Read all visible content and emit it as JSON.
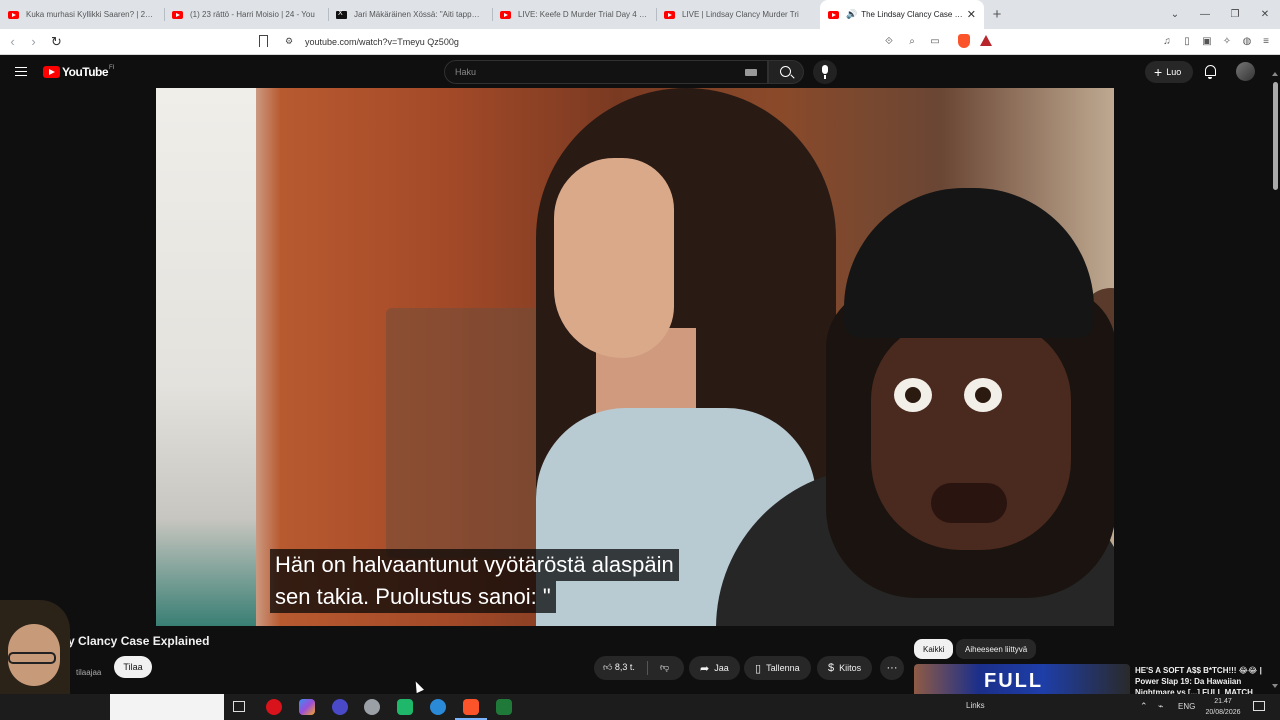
{
  "browser": {
    "tabs": [
      {
        "title": "Kuka murhasi Kyllikki Saaren? | 23 m",
        "icon": "youtube-icon",
        "active": false
      },
      {
        "title": "(1) 23 rättö - Harri Moisio | 24 - You",
        "icon": "youtube-icon",
        "active": false
      },
      {
        "title": "Jari Mäkäräinen Xössä: \"Aiti tappaa k",
        "icon": "x-icon",
        "active": false
      },
      {
        "title": "LIVE: Keefe D Murder Trial Day 4 | Off",
        "icon": "youtube-icon",
        "active": false
      },
      {
        "title": "LIVE | Lindsay Clancy Murder Tri",
        "icon": "youtube-icon",
        "active": false
      },
      {
        "title": "The Lindsay Clancy Case Expl",
        "icon": "youtube-icon",
        "active": true
      }
    ],
    "new_tab": "+",
    "url": "youtube.com/watch?v=Tmeyu Qz500g"
  },
  "youtube": {
    "logo_text": "YouTube",
    "country_code": "FI",
    "search_placeholder": "Haku",
    "create_label": "Luo",
    "subtitle_line1": "Hän on halvaantunut vyötäröstä alaspäin",
    "subtitle_line2": "sen takia. Puolustus sanoi: \"",
    "video_title": "y Clancy Case Explained",
    "channel_name": "tilaajaa",
    "subscribe_label": "Tilaa",
    "like_count": "8,3 t.",
    "share_label": "Jaa",
    "save_label": "Tallenna",
    "thanks_label": "Kiitos",
    "chips": [
      "Kaikki",
      "Aiheeseen liittyvä"
    ],
    "recommended": {
      "thumb_text": "FULL",
      "title": "HE'S A SOFT A$$ B*TCH!!! 😂😂 | Power Slap 19: Da Hawaiian Nightmare vs [...] FULL MATCH"
    }
  },
  "taskbar": {
    "links_label": "Links",
    "language": "ENG",
    "time": "21.47",
    "date": "20/08/2026"
  },
  "colors": {
    "youtube_red": "#ff0000",
    "dark_bg": "#0f0f0f",
    "pill_bg": "#272727",
    "brave_orange": "#fb542b"
  }
}
